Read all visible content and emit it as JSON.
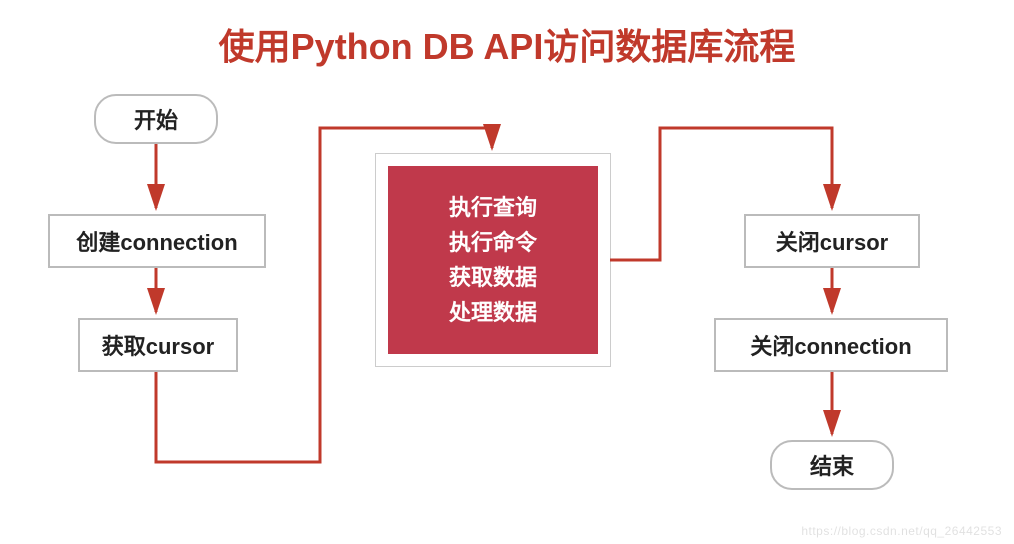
{
  "title": "使用Python DB API访问数据库流程",
  "nodes": {
    "start": "开始",
    "create_connection": "创建connection",
    "get_cursor": "获取cursor",
    "execute_steps": [
      "执行查询",
      "执行命令",
      "获取数据",
      "处理数据"
    ],
    "close_cursor": "关闭cursor",
    "close_connection": "关闭connection",
    "end": "结束"
  },
  "flow": [
    "开始",
    "创建connection",
    "获取cursor",
    "执行查询 / 执行命令 / 获取数据 / 处理数据",
    "关闭cursor",
    "关闭connection",
    "结束"
  ],
  "colors": {
    "accent": "#c0392b",
    "box_border": "#bbbbbb",
    "center_bg": "#c0394b"
  },
  "watermark": "https://blog.csdn.net/qq_26442553"
}
